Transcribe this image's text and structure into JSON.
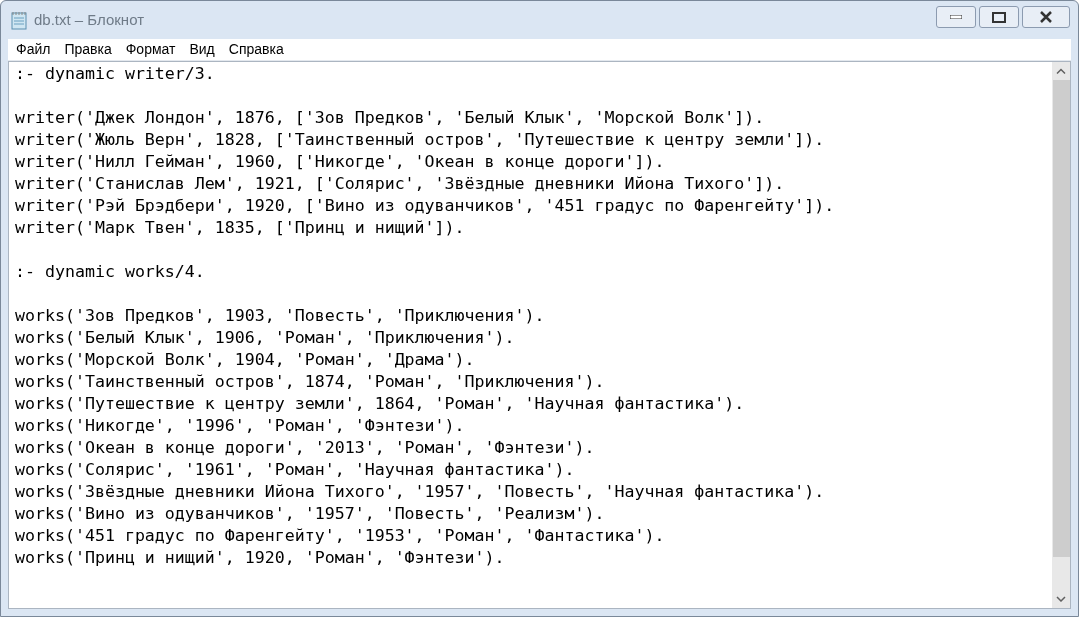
{
  "window": {
    "title": "db.txt – Блокнот",
    "active": false
  },
  "menu": [
    "Файл",
    "Правка",
    "Формат",
    "Вид",
    "Справка"
  ],
  "editor": {
    "blocks": [
      {
        "lines": [
          ":- dynamic writer/3."
        ]
      },
      {
        "lines": [
          "writer('Джек Лондон', 1876, ['Зов Предков', 'Белый Клык', 'Морской Волк']).",
          "writer('Жюль Верн', 1828, ['Таинственный остров', 'Путешествие к центру земли']).",
          "writer('Нилл Гейман', 1960, ['Никогде', 'Океан в конце дороги']).",
          "writer('Станислав Лем', 1921, ['Солярис', 'Звёздные дневники Ийона Тихого']).",
          "writer('Рэй Брэдбери', 1920, ['Вино из одуванчиков', '451 градус по Фаренгейту']).",
          "writer('Марк Твен', 1835, ['Принц и нищий'])."
        ]
      },
      {
        "lines": [
          ":- dynamic works/4."
        ]
      },
      {
        "lines": [
          "works('Зов Предков', 1903, 'Повесть', 'Приключения').",
          "works('Белый Клык', 1906, 'Роман', 'Приключения').",
          "works('Морской Волк', 1904, 'Роман', 'Драма').",
          "works('Таинственный остров', 1874, 'Роман', 'Приключения').",
          "works('Путешествие к центру земли', 1864, 'Роман', 'Научная фантастика').",
          "works('Никогде', '1996', 'Роман', 'Фэнтези').",
          "works('Океан в конце дороги', '2013', 'Роман', 'Фэнтези').",
          "works('Солярис', '1961', 'Роман', 'Научная фантастика').",
          "works('Звёздные дневники Ийона Тихого', '1957', 'Повесть', 'Научная фантастика').",
          "works('Вино из одуванчиков', '1957', 'Повесть', 'Реализм').",
          "works('451 градус по Фаренгейту', '1953', 'Роман', 'Фантастика').",
          "works('Принц и нищий', 1920, 'Роман', 'Фэнтези')."
        ]
      }
    ]
  }
}
